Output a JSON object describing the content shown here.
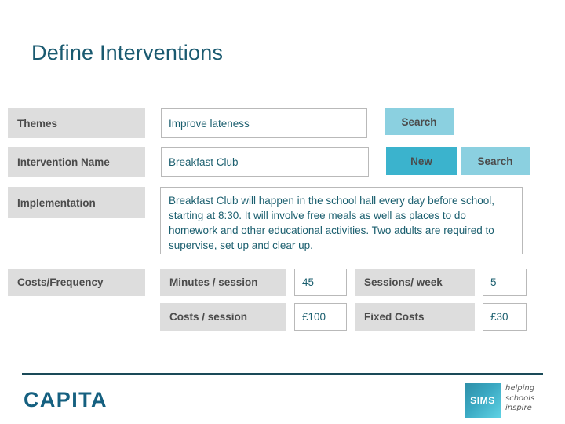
{
  "page": {
    "title": "Define Interventions"
  },
  "form": {
    "themes": {
      "label": "Themes",
      "value": "Improve lateness",
      "placeholder": "",
      "search_label": "Search"
    },
    "intervention_name": {
      "label": "Intervention Name",
      "value": "Breakfast Club",
      "placeholder": "",
      "new_label": "New",
      "search_label": "Search"
    },
    "implementation": {
      "label": "Implementation",
      "value": "Breakfast Club will happen in the school hall every day before school, starting at 8:30.  It will involve free meals as well as places to do homework and other educational activities.  Two adults are required to supervise, set up and  clear up.",
      "placeholder": ""
    },
    "costs_frequency": {
      "label": "Costs/Frequency",
      "fields": [
        {
          "label": "Minutes / session",
          "value": "45"
        },
        {
          "label": "Sessions/ week",
          "value": "5"
        },
        {
          "label": "Costs / session",
          "value": "£100"
        },
        {
          "label": "Fixed Costs",
          "value": "£30"
        }
      ]
    }
  },
  "footer": {
    "capita_logo": "CAPITA",
    "sims_logo": "SIMS",
    "sims_tagline": "helping\nschools\ninspire"
  },
  "colors": {
    "title": "#1a5a70",
    "label_bg": "#dddddd",
    "label_text": "#4b4b4b",
    "field_text": "#1a5e6e",
    "button_search": "#8bd0e0",
    "button_new": "#3bb3cd",
    "footer_rule": "#1a4a58",
    "capita": "#156080"
  }
}
